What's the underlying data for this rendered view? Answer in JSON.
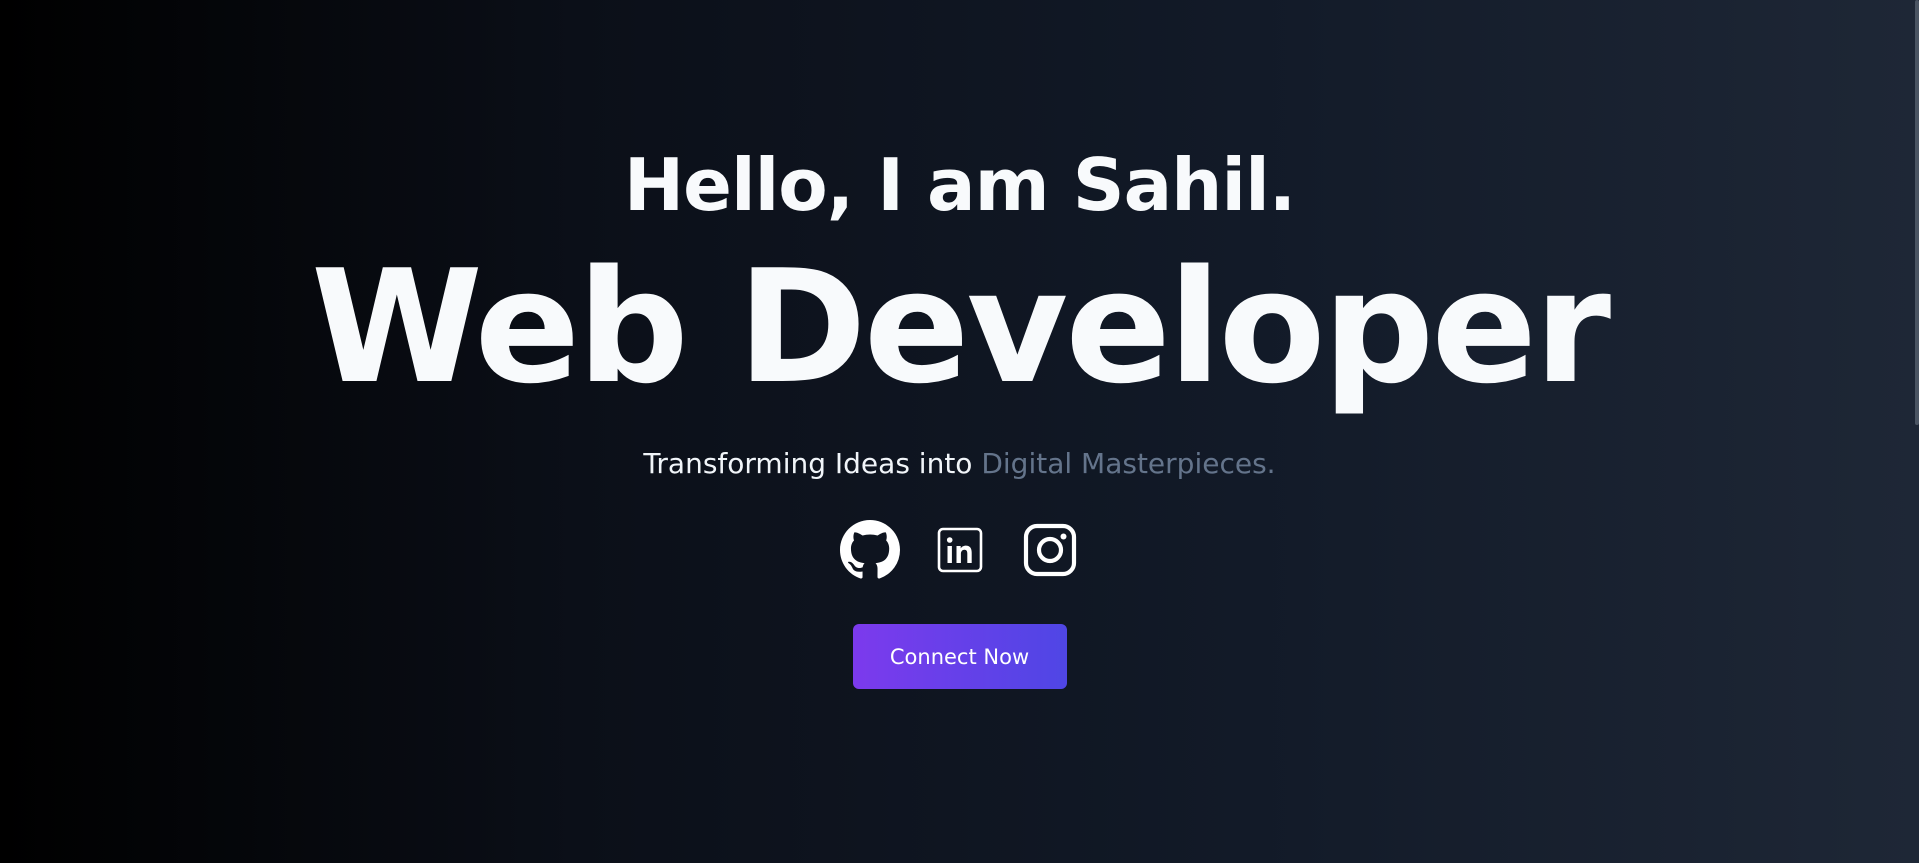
{
  "hero": {
    "greeting": "Hello, I am Sahil.",
    "role": "Web Developer",
    "tagline_prefix": "Transforming Ideas into",
    "tagline_accent": "Digital Masterpieces."
  },
  "socials": [
    {
      "icon": "github-icon"
    },
    {
      "icon": "linkedin-icon"
    },
    {
      "icon": "instagram-icon"
    }
  ],
  "cta": {
    "label": "Connect Now"
  },
  "colors": {
    "text": "#f8fafc",
    "accent_text": "#64748b",
    "button_start": "#7c3aed",
    "button_end": "#4f46e5"
  }
}
